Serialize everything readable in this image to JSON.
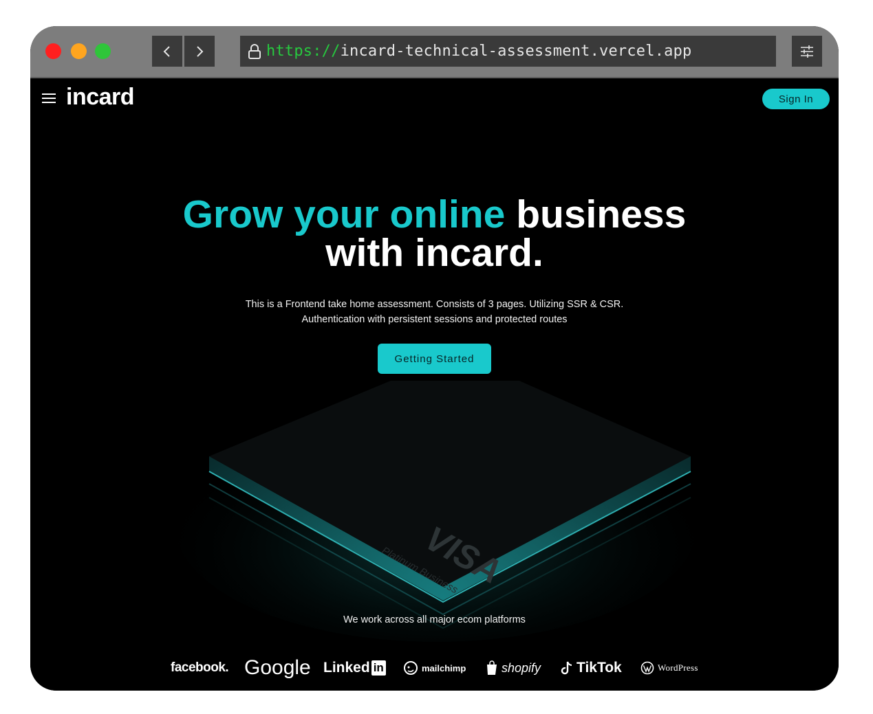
{
  "browser": {
    "url_scheme": "https://",
    "url_host": "incard-technical-assessment.vercel.app"
  },
  "header": {
    "logo_text": "incard",
    "signin_label": "Sign In"
  },
  "hero": {
    "title_accent": "Grow your online",
    "title_rest": " business",
    "title_line2": "with incard.",
    "description_line1": "This is a Frontend take home assessment. Consists of 3 pages. Utilizing SSR & CSR.",
    "description_line2": "Authentication with persistent sessions and protected routes",
    "cta_label": "Getting Started"
  },
  "card": {
    "brand": "VISA",
    "tier": "Platinum Business"
  },
  "platforms": {
    "label": "We work across all major ecom platforms",
    "logos": [
      "facebook.",
      "Google",
      "Linked",
      "in",
      "mailchimp",
      "shopify",
      "TikTok",
      "WordPress"
    ]
  },
  "colors": {
    "accent": "#19c9cc",
    "background": "#000000"
  }
}
